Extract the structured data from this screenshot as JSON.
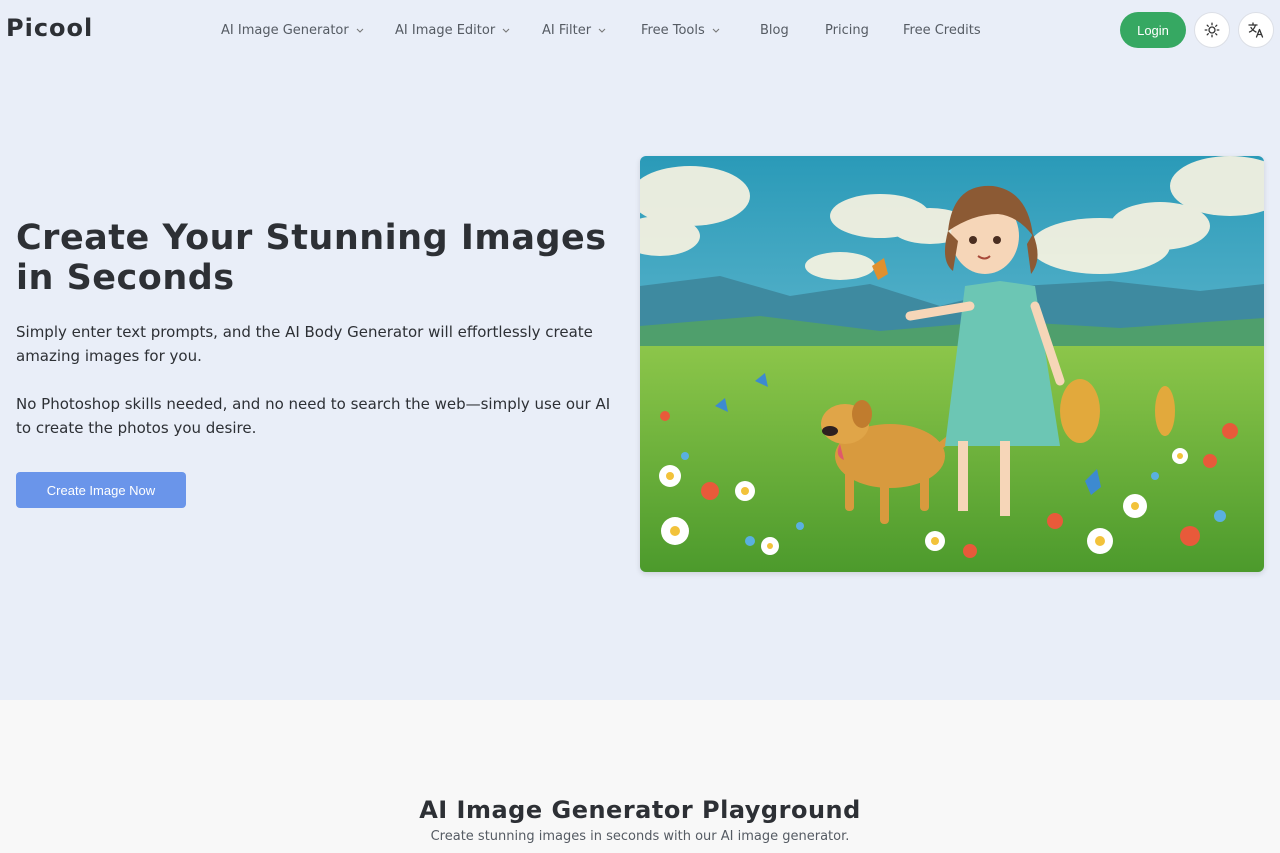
{
  "brand": {
    "name": "Picool"
  },
  "nav": {
    "items": [
      {
        "label": "AI Image Generator",
        "has_dropdown": true
      },
      {
        "label": "AI Image Editor",
        "has_dropdown": true
      },
      {
        "label": "AI Filter",
        "has_dropdown": true
      },
      {
        "label": "Free Tools",
        "has_dropdown": true
      },
      {
        "label": "Blog",
        "has_dropdown": false
      },
      {
        "label": "Pricing",
        "has_dropdown": false
      },
      {
        "label": "Free Credits",
        "has_dropdown": false
      }
    ],
    "login_label": "Login",
    "theme_icon": "sun-icon",
    "language_icon": "translate-icon"
  },
  "hero": {
    "title": "Create Your Stunning Images in Seconds",
    "paragraph1": "Simply enter text prompts, and the AI Body Generator will effortlessly create amazing images for you.",
    "paragraph2": "No Photoshop skills needed, and no need to search the web—simply use our AI to create the photos you desire.",
    "cta_label": "Create Image Now",
    "image_icon": "anime-girl-dog-meadow-illustration"
  },
  "playground": {
    "title": "AI Image Generator Playground",
    "subtitle": "Create stunning images in seconds with our AI image generator."
  },
  "colors": {
    "hero_bg": "#e9eef8",
    "login_green": "#36a862",
    "cta_blue": "#6a95ea"
  }
}
